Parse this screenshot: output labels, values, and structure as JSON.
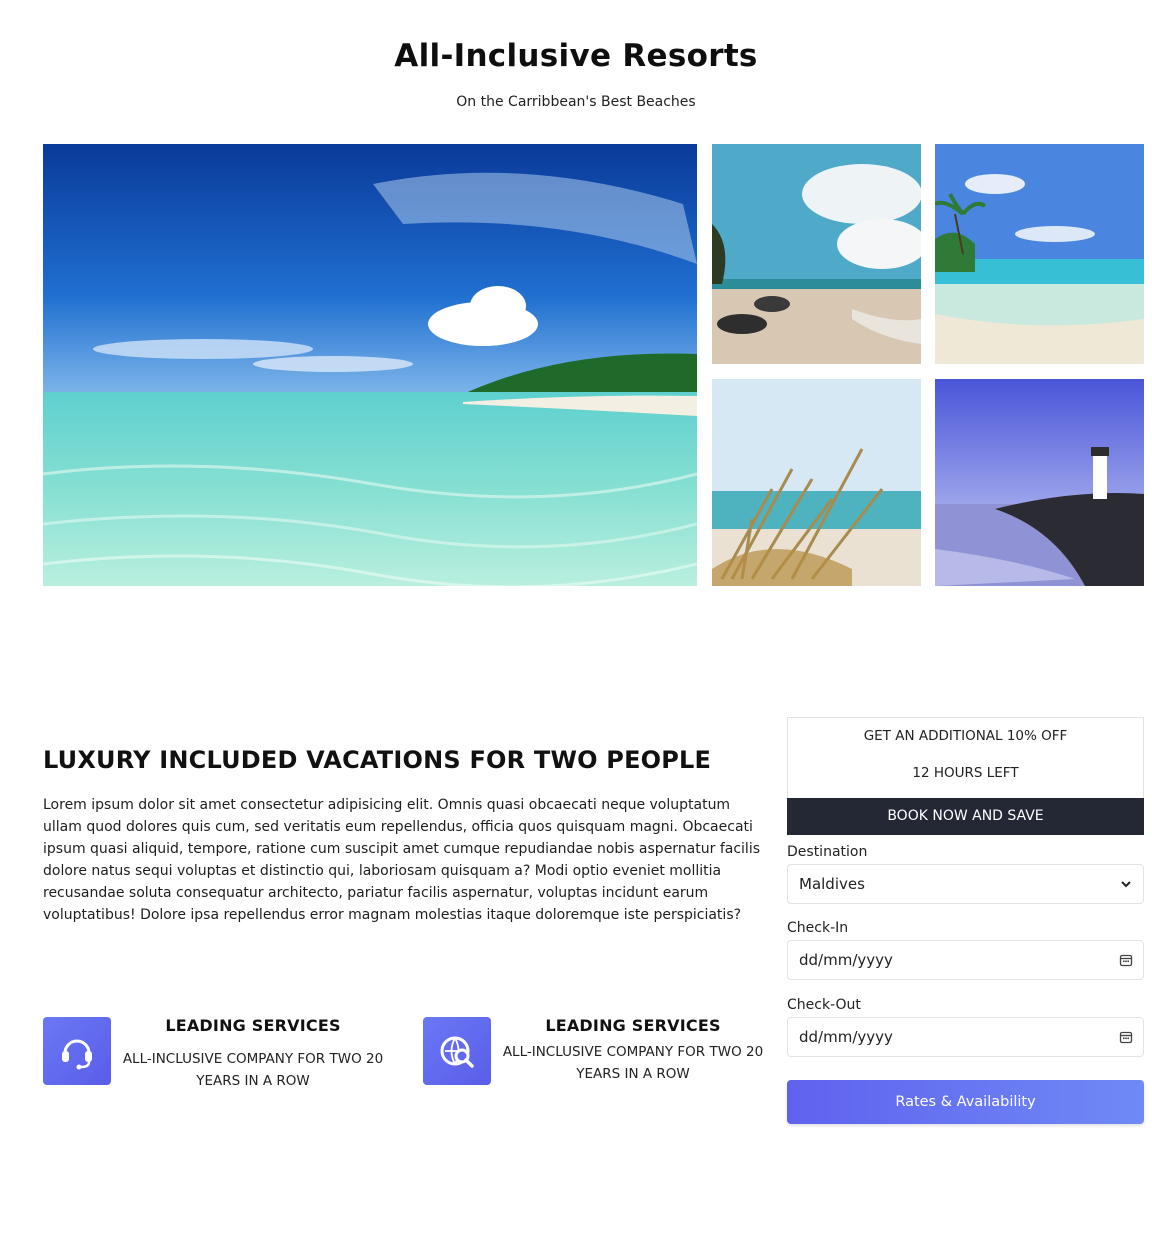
{
  "header": {
    "title": "All-Inclusive Resorts",
    "subtitle": "On the Carribbean's Best Beaches"
  },
  "gallery": {
    "images": [
      {
        "name": "main-beach-photo",
        "subject": "tropical island lagoon"
      },
      {
        "name": "rocky-beach-photo",
        "subject": "rocky shoreline beach"
      },
      {
        "name": "palm-beach-photo",
        "subject": "palm tree turquoise beach"
      },
      {
        "name": "dune-grass-photo",
        "subject": "beach dune grass"
      },
      {
        "name": "lighthouse-photo",
        "subject": "lighthouse at sunset"
      }
    ]
  },
  "content": {
    "heading": "LUXURY INCLUDED VACATIONS FOR TWO PEOPLE",
    "paragraph": "Lorem ipsum dolor sit amet consectetur adipisicing elit. Omnis quasi obcaecati neque voluptatum ullam quod dolores quis cum, sed veritatis eum repellendus, officia quos quisquam magni. Obcaecati ipsum quasi aliquid, tempore, ratione cum suscipit amet cumque repudiandae nobis aspernatur facilis dolore natus sequi voluptas et distinctio qui, laboriosam quisquam a? Modi optio eveniet mollitia recusandae soluta consequatur architecto, pariatur facilis aspernatur, voluptas incidunt earum voluptatibus! Dolore ipsa repellendus error magnam molestias itaque doloremque iste perspiciatis?"
  },
  "features": [
    {
      "heading": "LEADING SERVICES",
      "description": "ALL-INCLUSIVE COMPANY FOR TWO 20 YEARS IN A ROW",
      "icon": "headset-icon"
    },
    {
      "heading": "LEADING SERVICES",
      "description": "ALL-INCLUSIVE COMPANY FOR TWO 20 YEARS IN A ROW",
      "icon": "search-location-icon"
    }
  ],
  "booking": {
    "promo_line1": "GET AN ADDITIONAL 10% OFF",
    "promo_line2": "12 HOURS LEFT",
    "book_button": "BOOK NOW AND SAVE",
    "destination_label": "Destination",
    "destination_value": "Maldives",
    "checkin_label": "Check-In",
    "checkin_placeholder": "dd/mm/yyyy",
    "checkout_label": "Check-Out",
    "checkout_placeholder": "dd/mm/yyyy",
    "submit_button": "Rates & Availability"
  },
  "colors": {
    "accent": "#6a78f5",
    "dark_button": "#232834"
  }
}
